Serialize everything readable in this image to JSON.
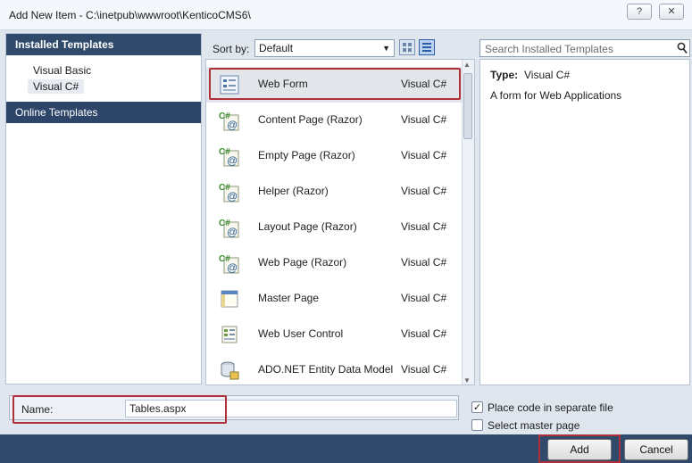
{
  "window": {
    "title": "Add New Item - C:\\inetpub\\wwwroot\\KenticoCMS6\\",
    "help_glyph": "?",
    "close_glyph": "✕"
  },
  "left_panel": {
    "installed_header": "Installed Templates",
    "tree": [
      "Visual Basic",
      "Visual C#"
    ],
    "online_header": "Online Templates"
  },
  "toolbar": {
    "sort_label": "Sort by:",
    "sort_value": "Default"
  },
  "templates": [
    {
      "name": "Web Form",
      "lang": "Visual C#",
      "icon": "web-form-icon"
    },
    {
      "name": "Content Page (Razor)",
      "lang": "Visual C#",
      "icon": "csharp-razor-icon"
    },
    {
      "name": "Empty Page (Razor)",
      "lang": "Visual C#",
      "icon": "csharp-razor-icon"
    },
    {
      "name": "Helper (Razor)",
      "lang": "Visual C#",
      "icon": "csharp-razor-icon"
    },
    {
      "name": "Layout Page (Razor)",
      "lang": "Visual C#",
      "icon": "csharp-razor-icon"
    },
    {
      "name": "Web Page (Razor)",
      "lang": "Visual C#",
      "icon": "csharp-razor-icon"
    },
    {
      "name": "Master Page",
      "lang": "Visual C#",
      "icon": "master-page-icon"
    },
    {
      "name": "Web User Control",
      "lang": "Visual C#",
      "icon": "user-control-icon"
    },
    {
      "name": "ADO.NET Entity Data Model",
      "lang": "Visual C#",
      "icon": "entity-model-icon"
    }
  ],
  "search": {
    "placeholder": "Search Installed Templates"
  },
  "details": {
    "type_label": "Type:",
    "type_value": "Visual C#",
    "description": "A form for Web Applications"
  },
  "bottom": {
    "name_label": "Name:",
    "name_value": "Tables.aspx",
    "place_code_label": "Place code in separate file",
    "place_code_checked": true,
    "master_page_label": "Select master page",
    "master_page_checked": false,
    "add_label": "Add",
    "cancel_label": "Cancel"
  },
  "colors": {
    "accent_header": "#2f4a6b",
    "highlight_red": "#b0303a"
  }
}
